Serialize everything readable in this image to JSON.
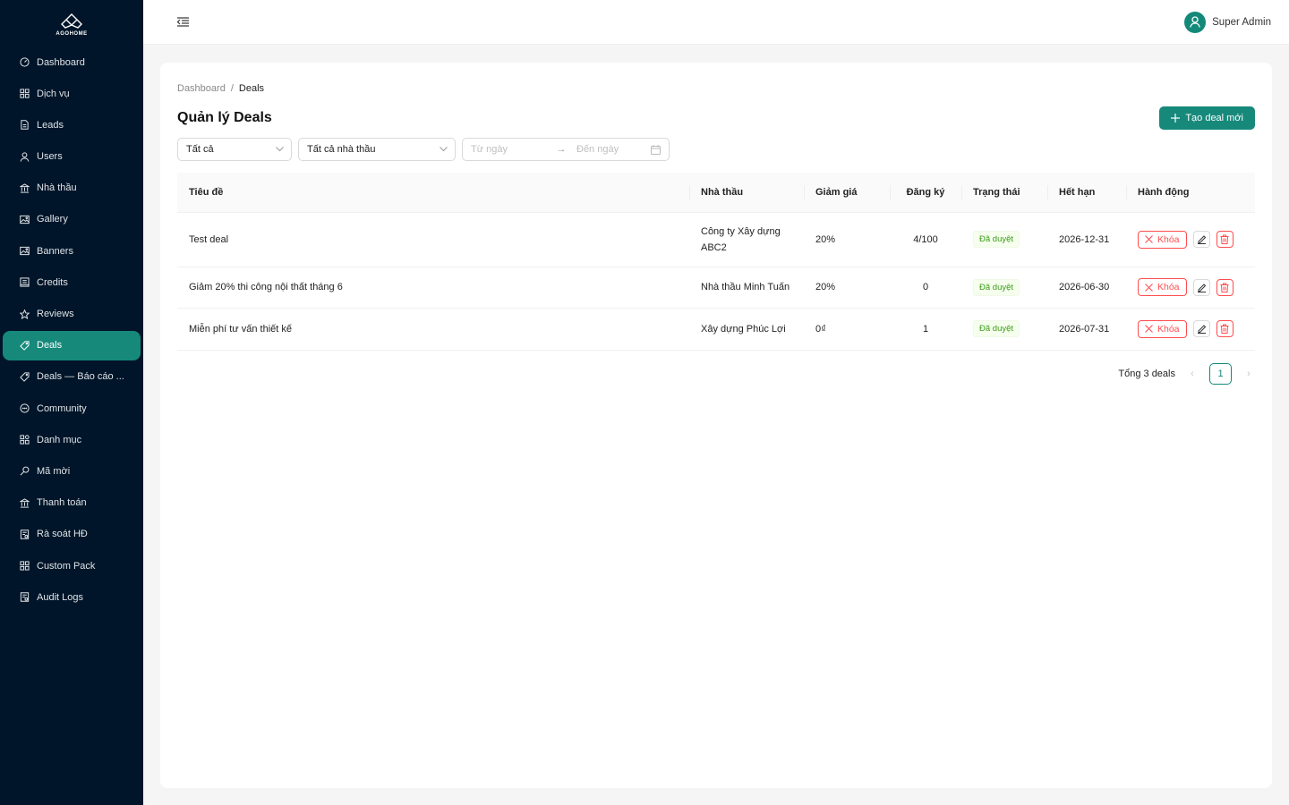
{
  "app": {
    "logo_text": "AGOHOME"
  },
  "sidebar": {
    "items": [
      {
        "label": "Dashboard",
        "icon": "dashboard-icon"
      },
      {
        "label": "Dịch vụ",
        "icon": "grid-icon"
      },
      {
        "label": "Leads",
        "icon": "file-icon"
      },
      {
        "label": "Users",
        "icon": "user-icon"
      },
      {
        "label": "Nhà thầu",
        "icon": "bank-icon"
      },
      {
        "label": "Gallery",
        "icon": "picture-icon"
      },
      {
        "label": "Banners",
        "icon": "picture-icon"
      },
      {
        "label": "Credits",
        "icon": "credit-icon"
      },
      {
        "label": "Reviews",
        "icon": "star-icon"
      },
      {
        "label": "Deals",
        "icon": "tag-icon",
        "active": true
      },
      {
        "label": "Deals — Báo cáo ...",
        "icon": "tag-icon"
      },
      {
        "label": "Community",
        "icon": "message-icon"
      },
      {
        "label": "Danh mục",
        "icon": "category-icon"
      },
      {
        "label": "Mã mời",
        "icon": "key-icon"
      },
      {
        "label": "Thanh toán",
        "icon": "bank-icon"
      },
      {
        "label": "Rà soát HĐ",
        "icon": "audit-icon"
      },
      {
        "label": "Custom Pack",
        "icon": "grid-icon"
      },
      {
        "label": "Audit Logs",
        "icon": "audit-icon"
      }
    ]
  },
  "header": {
    "user_name": "Super Admin"
  },
  "breadcrumb": {
    "home": "Dashboard",
    "separator": "/",
    "current": "Deals"
  },
  "page": {
    "title": "Quản lý Deals",
    "create_button": "Tạo deal mới"
  },
  "filters": {
    "status_value": "Tất cả",
    "contractor_value": "Tất cả nhà thầu",
    "date_from_placeholder": "Từ ngày",
    "date_to_placeholder": "Đến ngày"
  },
  "table": {
    "columns": [
      "Tiêu đề",
      "Nhà thầu",
      "Giảm giá",
      "Đăng ký",
      "Trạng thái",
      "Hết hạn",
      "Hành động"
    ],
    "rows": [
      {
        "title": "Test deal",
        "contractor": "Công ty Xây dựng ABC2",
        "discount": "20%",
        "registered": "4/100",
        "status": "Đã duyệt",
        "expires": "2026-12-31",
        "lock_label": "Khóa"
      },
      {
        "title": "Giảm 20% thi công nội thất tháng 6",
        "contractor": "Nhà thầu Minh Tuấn",
        "discount": "20%",
        "registered": "0",
        "status": "Đã duyệt",
        "expires": "2026-06-30",
        "lock_label": "Khóa"
      },
      {
        "title": "Miễn phí tư vấn thiết kế",
        "contractor": "Xây dựng Phúc Lợi",
        "discount": "0₫",
        "registered": "1",
        "status": "Đã duyệt",
        "expires": "2026-07-31",
        "lock_label": "Khóa"
      }
    ]
  },
  "pagination": {
    "total_text": "Tổng 3 deals",
    "current_page": "1"
  },
  "colors": {
    "primary": "#16897b",
    "sidebar_bg": "#001529",
    "danger": "#ff4d4f",
    "success": "#3a9a1a"
  }
}
